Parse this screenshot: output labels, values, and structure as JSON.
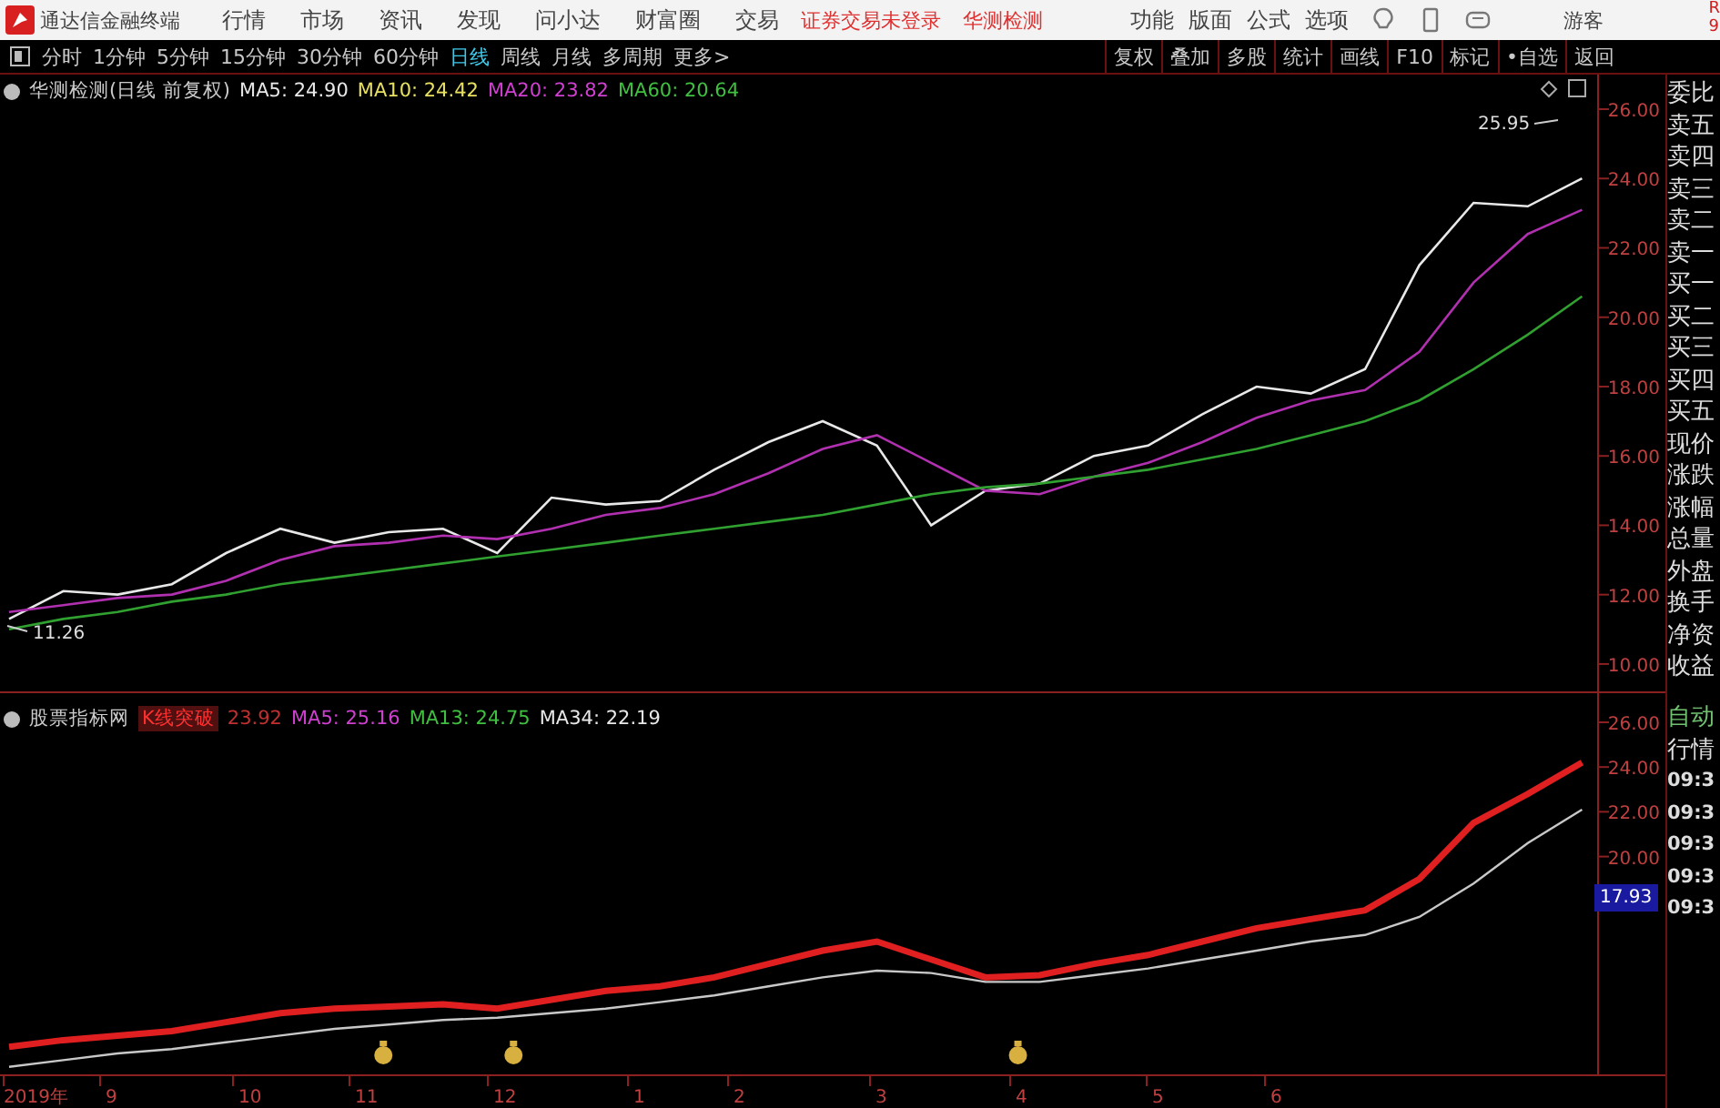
{
  "app_bar": {
    "title": "通达信金融终端",
    "menu": [
      "行情",
      "市场",
      "资讯",
      "发现",
      "问小达",
      "财富圈",
      "交易"
    ],
    "login_status": "证券交易未登录",
    "stock_name": "华测检测",
    "tools": [
      "功能",
      "版面",
      "公式",
      "选项"
    ],
    "user": "游客",
    "corner_text": [
      "R",
      "9"
    ]
  },
  "toolbar": {
    "periods": [
      {
        "label": "分时",
        "selected": false
      },
      {
        "label": "1分钟",
        "selected": false
      },
      {
        "label": "5分钟",
        "selected": false
      },
      {
        "label": "15分钟",
        "selected": false
      },
      {
        "label": "30分钟",
        "selected": false
      },
      {
        "label": "60分钟",
        "selected": false
      },
      {
        "label": "日线",
        "selected": true
      },
      {
        "label": "周线",
        "selected": false
      },
      {
        "label": "月线",
        "selected": false
      },
      {
        "label": "多周期",
        "selected": false
      }
    ],
    "more": "更多>",
    "buttons": [
      "复权",
      "叠加",
      "多股",
      "统计",
      "画线",
      "F10",
      "标记",
      "•自选",
      "返回"
    ]
  },
  "main_chart": {
    "legend": {
      "title": "华测检测(日线 前复权)",
      "indicators": [
        {
          "label": "MA5: 24.90",
          "color": "#e8e8e8"
        },
        {
          "label": "MA10: 24.42",
          "color": "#e8e060"
        },
        {
          "label": "MA20: 23.82",
          "color": "#d040d0"
        },
        {
          "label": "MA60: 20.64",
          "color": "#40c040"
        }
      ]
    },
    "y_axis_labels": [
      "26.00",
      "24.00",
      "22.00",
      "20.00",
      "18.00",
      "16.00",
      "14.00",
      "12.00",
      "10.00"
    ],
    "high_label": "25.95",
    "low_label": "11.26"
  },
  "lower_chart": {
    "legend": {
      "title": "股票指标网",
      "signal": "K线突破",
      "value": "23.92",
      "indicators": [
        {
          "label": "MA5: 25.16",
          "color": "#d040d0"
        },
        {
          "label": "MA13: 24.75",
          "color": "#40c040"
        },
        {
          "label": "MA34: 22.19",
          "color": "#e8e8e8"
        }
      ]
    },
    "y_axis_labels": [
      "26.00",
      "24.00",
      "22.00",
      "20.00"
    ],
    "current_value": "17.93",
    "x_axis_labels": [
      "2019年",
      "9",
      "10",
      "11",
      "12",
      "1",
      "2",
      "3",
      "4",
      "5",
      "6"
    ]
  },
  "side_panel": {
    "quote_labels": [
      "委比",
      "卖五",
      "卖四",
      "卖三",
      "卖二",
      "卖一",
      "买一",
      "买二",
      "买三",
      "买四",
      "买五",
      "现价",
      "涨跌",
      "涨幅",
      "总量",
      "外盘",
      "换手",
      "净资",
      "收益"
    ],
    "lower_labels": [
      {
        "label": "自动",
        "kind": "mode"
      },
      {
        "label": "行情",
        "kind": "mode"
      },
      {
        "label": "09:3",
        "kind": "time"
      },
      {
        "label": "09:3",
        "kind": "time"
      },
      {
        "label": "09:3",
        "kind": "time"
      },
      {
        "label": "09:3",
        "kind": "time"
      },
      {
        "label": "09:3",
        "kind": "time"
      }
    ]
  }
}
